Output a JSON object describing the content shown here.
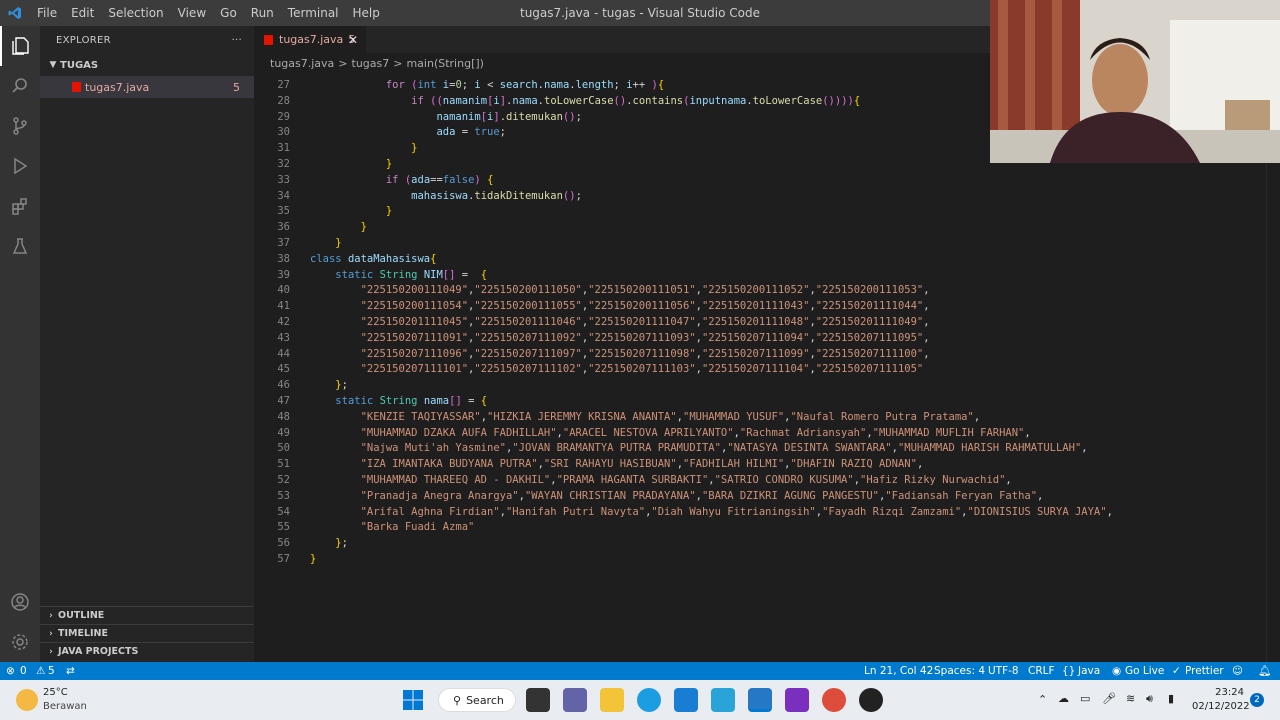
{
  "window_title": "tugas7.java - tugas - Visual Studio Code",
  "menu": [
    "File",
    "Edit",
    "Selection",
    "View",
    "Go",
    "Run",
    "Terminal",
    "Help"
  ],
  "explorer": {
    "title": "EXPLORER",
    "folder": "TUGAS",
    "file": "tugas7.java",
    "file_problems": "5",
    "sections": [
      "OUTLINE",
      "TIMELINE",
      "JAVA PROJECTS"
    ]
  },
  "tab": {
    "label": "tugas7.java",
    "count": "5"
  },
  "breadcrumb": [
    "tugas7.java",
    ">",
    "tugas7",
    ">",
    "main(String[])"
  ],
  "code_lines": [
    {
      "n": "27",
      "t": "            for (int i=0; i < search.nama.length; i++ ){"
    },
    {
      "n": "28",
      "t": "                if ((namanim[i].nama.toLowerCase().contains(inputnama.toLowerCase()))){"
    },
    {
      "n": "29",
      "t": "                    namanim[i].ditemukan();"
    },
    {
      "n": "30",
      "t": "                    ada = true;"
    },
    {
      "n": "31",
      "t": "                }"
    },
    {
      "n": "32",
      "t": "            }"
    },
    {
      "n": "33",
      "t": "            if (ada==false) {"
    },
    {
      "n": "34",
      "t": "                mahasiswa.tidakDitemukan();"
    },
    {
      "n": "35",
      "t": "            }"
    },
    {
      "n": "36",
      "t": "        }"
    },
    {
      "n": "37",
      "t": "    }"
    },
    {
      "n": "38",
      "t": "class dataMahasiswa{"
    },
    {
      "n": "39",
      "t": "    static String NIM[] =  {"
    },
    {
      "n": "40",
      "t": "        \"225150200111049\",\"225150200111050\",\"225150200111051\",\"225150200111052\",\"225150200111053\","
    },
    {
      "n": "41",
      "t": "        \"225150200111054\",\"225150200111055\",\"225150200111056\",\"225150201111043\",\"225150201111044\","
    },
    {
      "n": "42",
      "t": "        \"225150201111045\",\"225150201111046\",\"225150201111047\",\"225150201111048\",\"225150201111049\","
    },
    {
      "n": "43",
      "t": "        \"225150207111091\",\"225150207111092\",\"225150207111093\",\"225150207111094\",\"225150207111095\","
    },
    {
      "n": "44",
      "t": "        \"225150207111096\",\"225150207111097\",\"225150207111098\",\"225150207111099\",\"225150207111100\","
    },
    {
      "n": "45",
      "t": "        \"225150207111101\",\"225150207111102\",\"225150207111103\",\"225150207111104\",\"225150207111105\""
    },
    {
      "n": "46",
      "t": "    };"
    },
    {
      "n": "47",
      "t": "    static String nama[] = {"
    },
    {
      "n": "48",
      "t": "        \"KENZIE TAQIYASSAR\",\"HIZKIA JEREMMY KRISNA ANANTA\",\"MUHAMMAD YUSUF\",\"Naufal Romero Putra Pratama\","
    },
    {
      "n": "49",
      "t": "        \"MUHAMMAD DZAKA AUFA FADHILLAH\",\"ARACEL NESTOVA APRILYANTO\",\"Rachmat Adriansyah\",\"MUHAMMAD MUFLIH FARHAN\","
    },
    {
      "n": "50",
      "t": "        \"Najwa Muti'ah Yasmine\",\"JOVAN BRAMANTYA PUTRA PRAMUDITA\",\"NATASYA DESINTA SWANTARA\",\"MUHAMMAD HARISH RAHMATULLAH\","
    },
    {
      "n": "51",
      "t": "        \"IZA IMANTAKA BUDYANA PUTRA\",\"SRI RAHAYU HASIBUAN\",\"FADHILAH HILMI\",\"DHAFIN RAZIQ ADNAN\","
    },
    {
      "n": "52",
      "t": "        \"MUHAMMAD THAREEQ AD - DAKHIL\",\"PRAMA HAGANTA SURBAKTI\",\"SATRIO CONDRO KUSUMA\",\"Hafiz Rizky Nurwachid\","
    },
    {
      "n": "53",
      "t": "        \"Pranadja Anegra Anargya\",\"WAYAN CHRISTIAN PRADAYANA\",\"BARA DZIKRI AGUNG PANGESTU\",\"Fadiansah Feryan Fatha\","
    },
    {
      "n": "54",
      "t": "        \"Arifal Aghna Firdian\",\"Hanifah Putri Navyta\",\"Diah Wahyu Fitrianingsih\",\"Fayadh Rizqi Zamzami\",\"DIONISIUS SURYA JAYA\","
    },
    {
      "n": "55",
      "t": "        \"Barka Fuadi Azma\""
    },
    {
      "n": "56",
      "t": "    };"
    },
    {
      "n": "57",
      "t": "}"
    }
  ],
  "status": {
    "errors": "0",
    "warnings": "5",
    "position": "Ln 21, Col 42",
    "spaces": "Spaces: 4",
    "encoding": "UTF-8",
    "eol": "CRLF",
    "language": "Java",
    "golive": "Go Live",
    "prettier": "Prettier"
  },
  "taskbar": {
    "weather_temp": "25°C",
    "weather_desc": "Berawan",
    "search": "Search",
    "time": "23:24",
    "date": "02/12/2022",
    "notif": "2"
  },
  "colors": {
    "accent": "#007acc",
    "editor_bg": "#1e1e1e",
    "sidebar_bg": "#252526",
    "activity_bg": "#333333",
    "error": "#e8a9a0"
  }
}
